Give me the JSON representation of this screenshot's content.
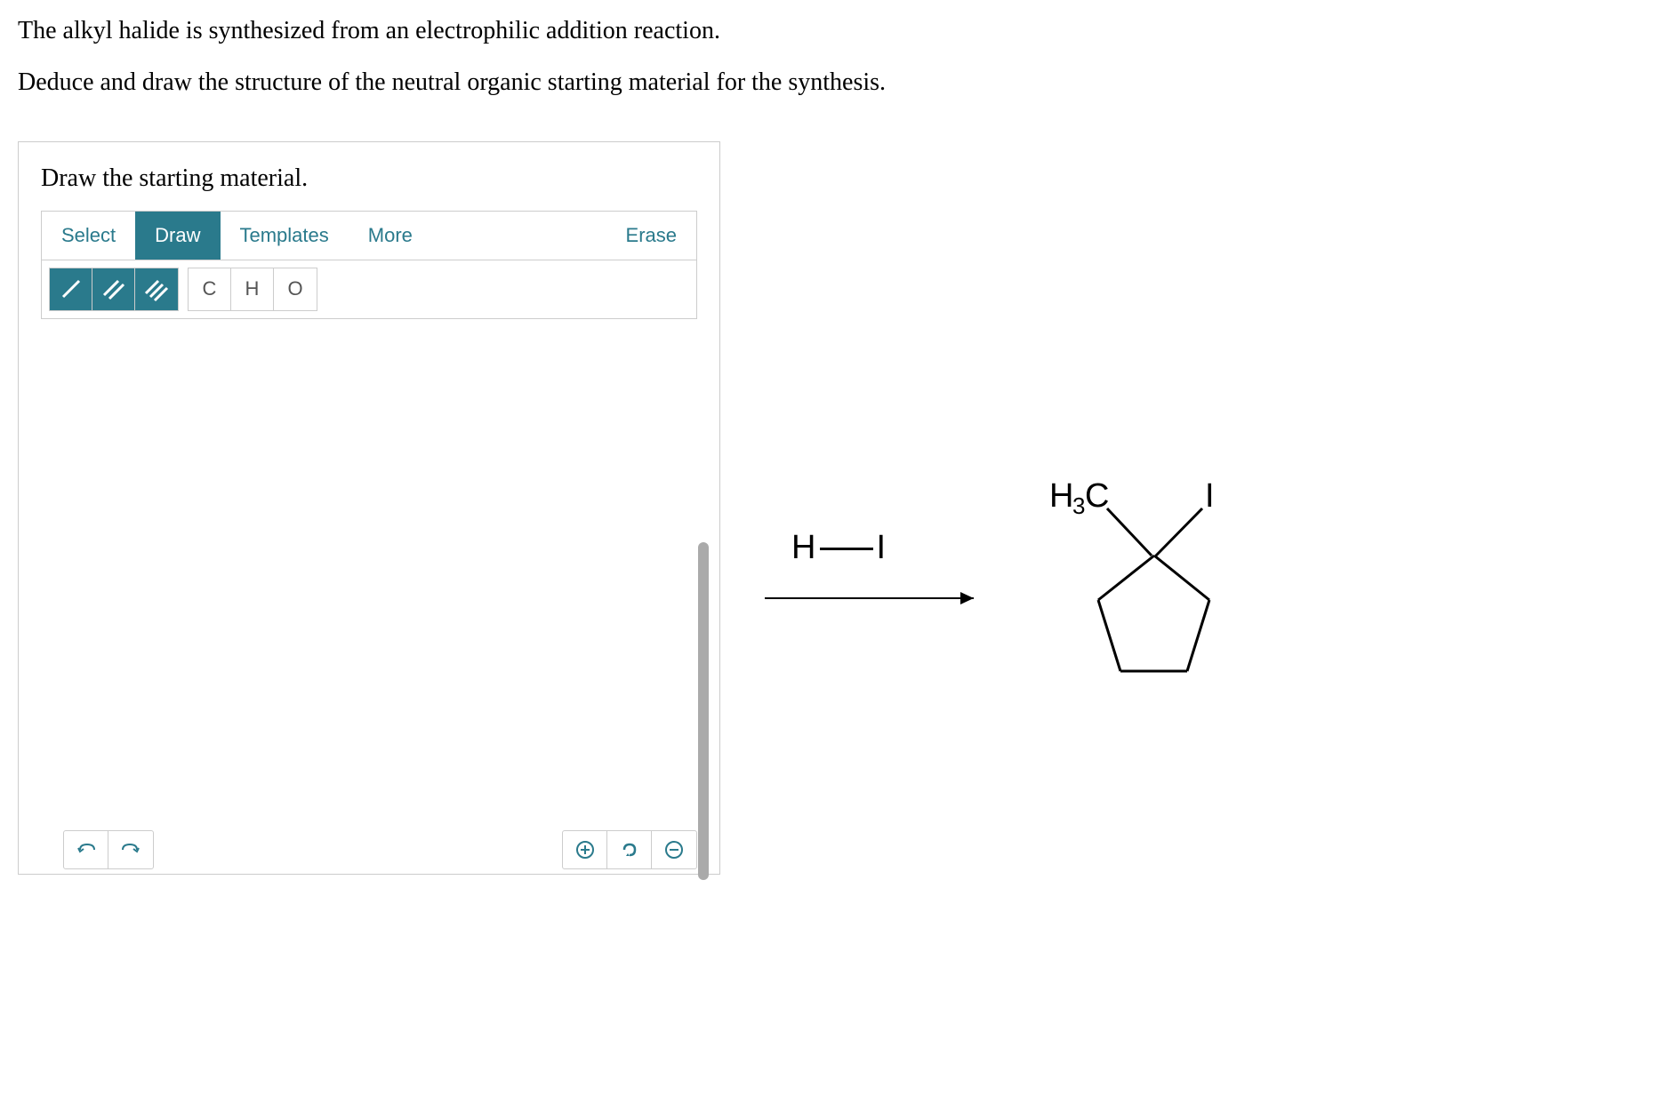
{
  "question": {
    "line1": "The alkyl halide is synthesized from an electrophilic addition reaction.",
    "line2": "Deduce and draw the structure of the neutral organic starting material for the synthesis."
  },
  "drawing": {
    "header": "Draw the starting material.",
    "tabs": {
      "select": "Select",
      "draw": "Draw",
      "templates": "Templates",
      "more": "More"
    },
    "erase": "Erase",
    "atoms": {
      "c": "C",
      "h": "H",
      "o": "O"
    }
  },
  "reaction": {
    "reagent": "H——I",
    "product_ch3": "H₃C",
    "product_i": "I"
  }
}
